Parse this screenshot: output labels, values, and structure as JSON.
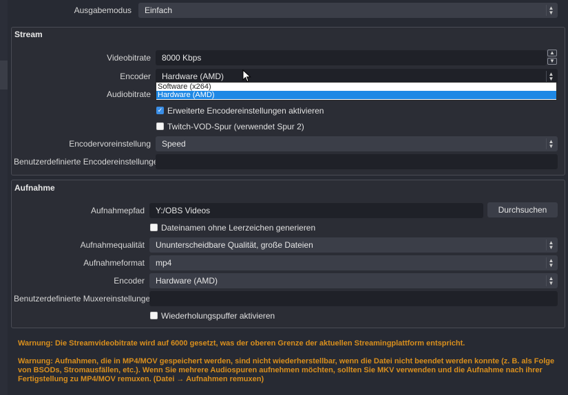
{
  "output_mode": {
    "label": "Ausgabemodus",
    "value": "Einfach"
  },
  "stream": {
    "title": "Stream",
    "video_bitrate": {
      "label": "Videobitrate",
      "value": "8000 Kbps"
    },
    "encoder": {
      "label": "Encoder",
      "value": "Hardware (AMD)",
      "options": [
        "Software (x264)",
        "Hardware (AMD)"
      ]
    },
    "audio_bitrate": {
      "label": "Audiobitrate"
    },
    "advanced_encoder": {
      "label": "Erweiterte Encodereinstellungen aktivieren",
      "checked": true
    },
    "twitch_vod": {
      "label": "Twitch-VOD-Spur (verwendet Spur 2)",
      "checked": false
    },
    "encoder_preset": {
      "label": "Encodervoreinstellung",
      "value": "Speed"
    },
    "custom_encoder": {
      "label": "Benutzerdefinierte Encodereinstellungen",
      "value": ""
    }
  },
  "recording": {
    "title": "Aufnahme",
    "path": {
      "label": "Aufnahmepfad",
      "value": "Y:/OBS Videos",
      "browse": "Durchsuchen"
    },
    "no_spaces": {
      "label": "Dateinamen ohne Leerzeichen generieren",
      "checked": false
    },
    "quality": {
      "label": "Aufnahmequalität",
      "value": "Ununterscheidbare Qualität, große Dateien"
    },
    "format": {
      "label": "Aufnahmeformat",
      "value": "mp4"
    },
    "encoder": {
      "label": "Encoder",
      "value": "Hardware (AMD)"
    },
    "custom_muxer": {
      "label": "Benutzerdefinierte Muxereinstellungen",
      "value": ""
    },
    "replay_buffer": {
      "label": "Wiederholungspuffer aktivieren",
      "checked": false
    }
  },
  "warnings": {
    "bitrate": "Warnung: Die Streamvideobitrate wird auf 6000 gesetzt, was der oberen Grenze der aktuellen Streamingplattform entspricht.",
    "mp4": "Warnung: Aufnahmen, die in MP4/MOV gespeichert werden, sind nicht wiederherstellbar, wenn die Datei nicht beendet werden konnte (z. B. als Folge von BSODs, Stromausfällen, etc.). Wenn Sie mehrere Audiospuren aufnehmen möchten, sollten Sie MKV verwenden und die Aufnahme nach ihrer Fertigstellung zu MP4/MOV remuxen. (Datei → Aufnahmen remuxen)"
  },
  "colors": {
    "accent": "#3a8ee6",
    "warning": "#d98f1d",
    "selection": "#1e88e5"
  }
}
